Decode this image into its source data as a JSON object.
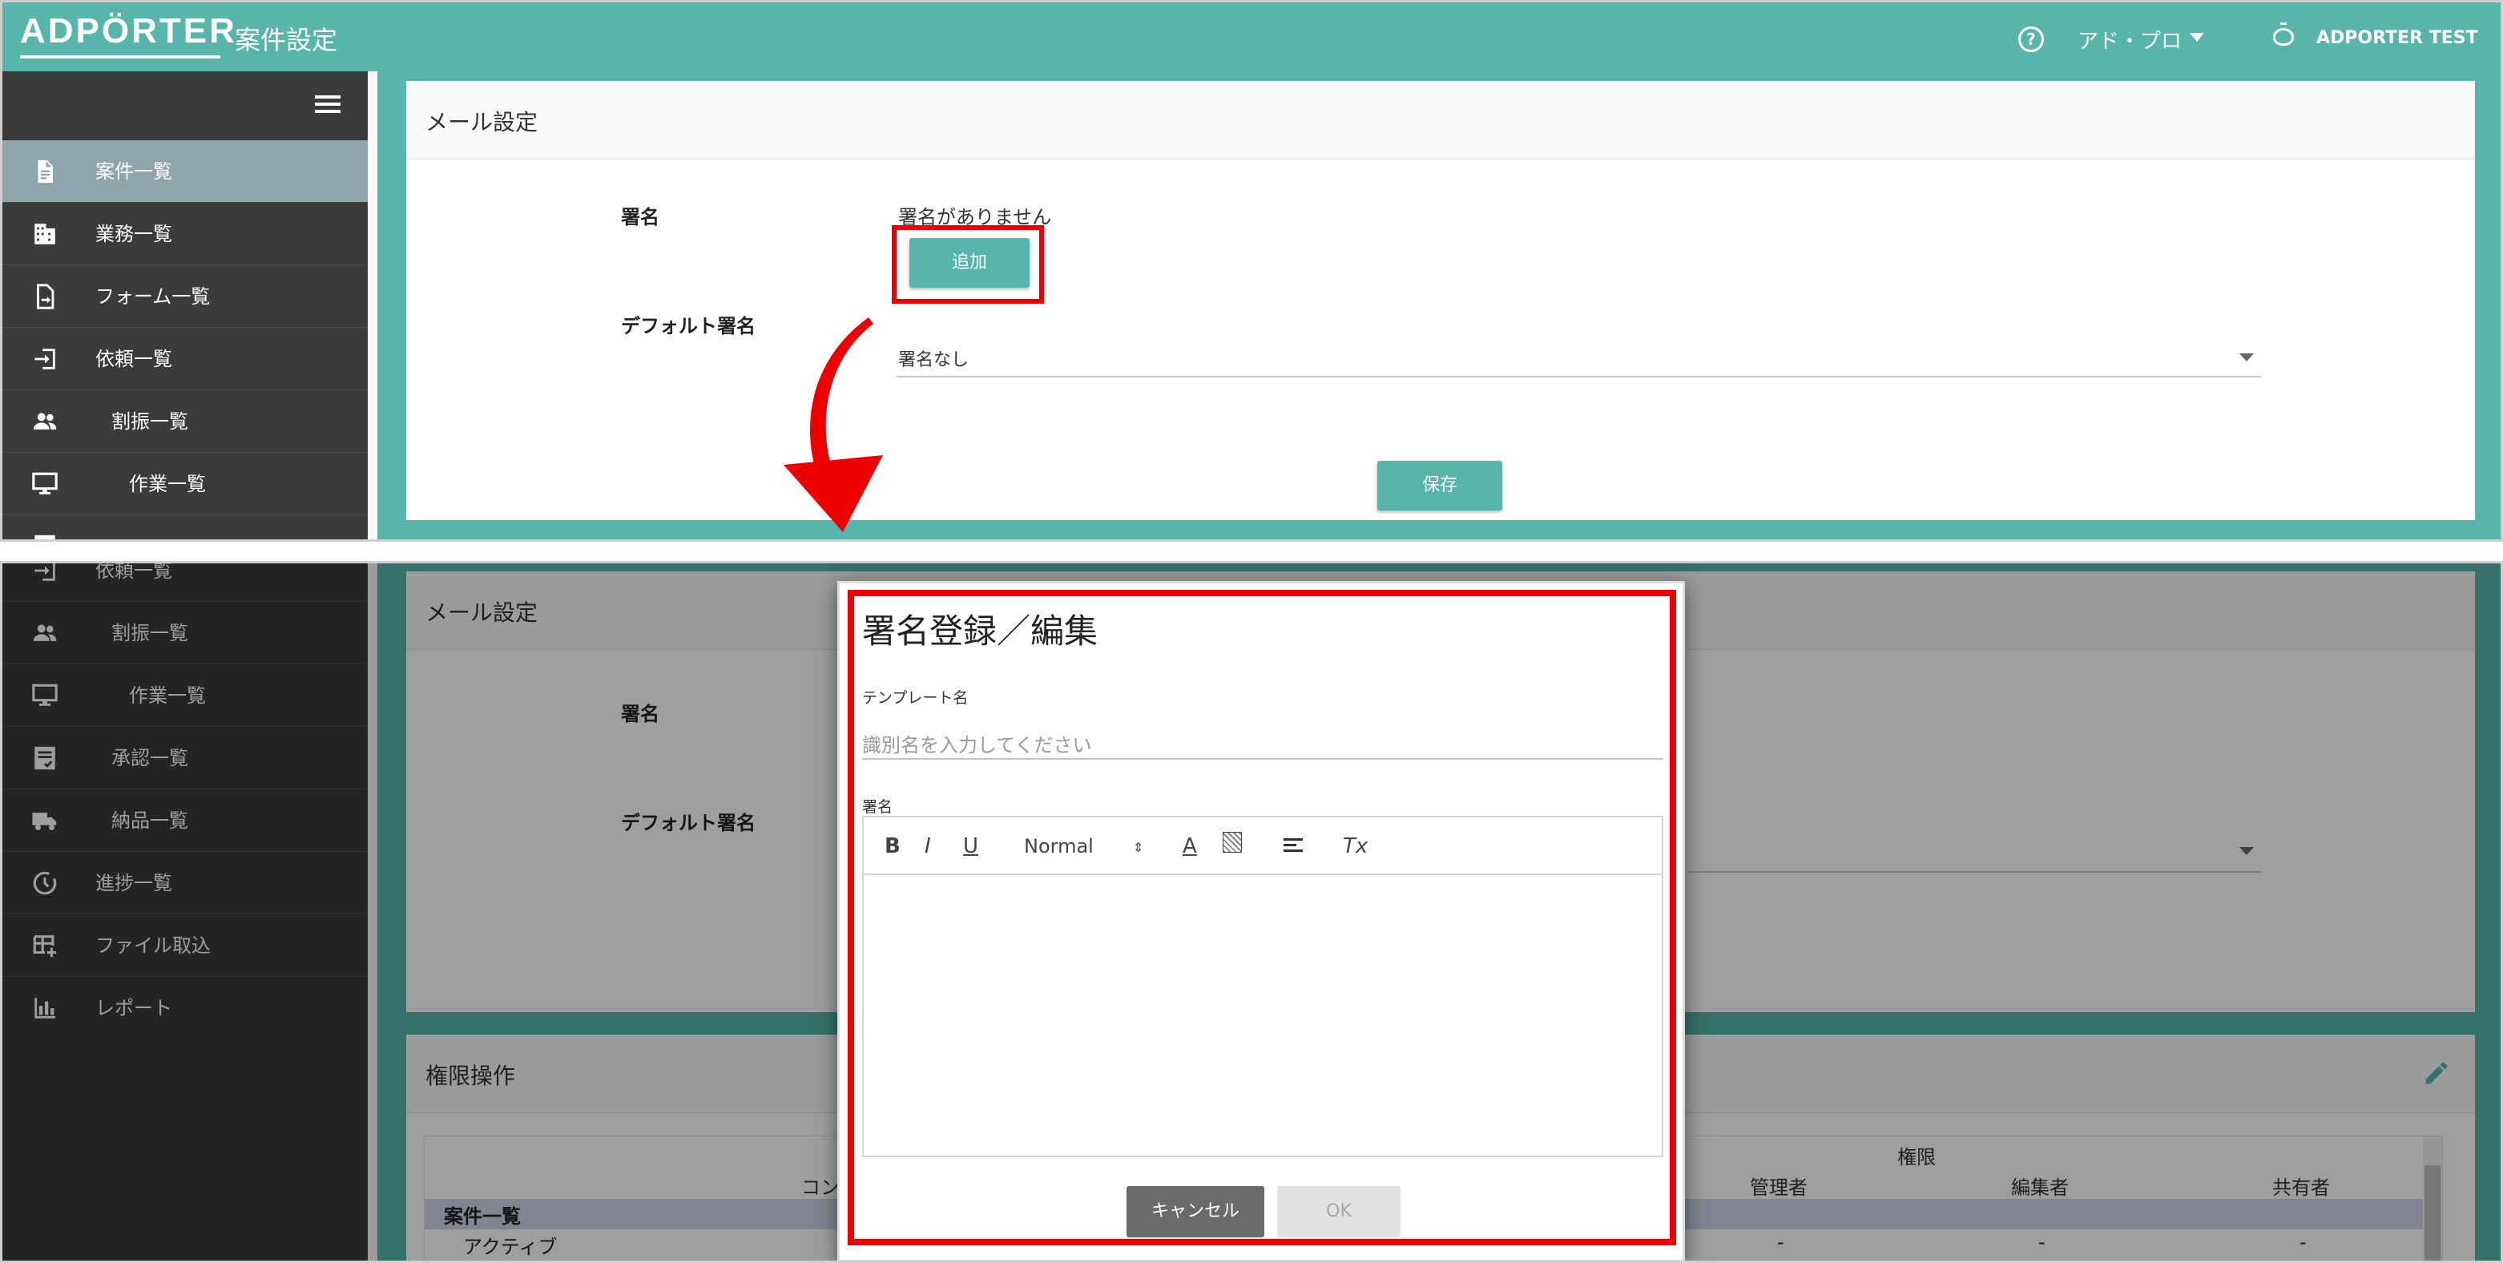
{
  "header": {
    "logo": "ADPÖRTER",
    "title": "案件設定",
    "help_icon": "question-circle-icon",
    "org": "アド・プロ",
    "user": "ADPORTER TEST"
  },
  "sidebar_top": {
    "items": [
      {
        "label": "案件一覧",
        "icon": "document-icon",
        "active": true
      },
      {
        "label": "業務一覧",
        "icon": "building-icon"
      },
      {
        "label": "フォーム一覧",
        "icon": "form-file-icon"
      },
      {
        "label": "依頼一覧",
        "icon": "login-arrow-icon"
      },
      {
        "label": "割振一覧",
        "icon": "people-icon"
      },
      {
        "label": "作業一覧",
        "icon": "monitor-icon"
      }
    ]
  },
  "sidebar_bottom": {
    "items": [
      {
        "label": "依頼一覧",
        "icon": "login-arrow-icon"
      },
      {
        "label": "割振一覧",
        "icon": "people-icon"
      },
      {
        "label": "作業一覧",
        "icon": "monitor-icon"
      },
      {
        "label": "承認一覧",
        "icon": "approval-icon"
      },
      {
        "label": "納品一覧",
        "icon": "truck-icon"
      },
      {
        "label": "進捗一覧",
        "icon": "clock-icon"
      },
      {
        "label": "ファイル取込",
        "icon": "table-add-icon"
      },
      {
        "label": "レポート",
        "icon": "bar-chart-icon"
      }
    ]
  },
  "mail_settings": {
    "title": "メール設定",
    "signature_label": "署名",
    "no_signature": "署名がありません",
    "add_button": "追加",
    "default_signature_label": "デフォルト署名",
    "default_signature_value": "署名なし",
    "save_button": "保存"
  },
  "permissions": {
    "title": "権限操作",
    "group_header": "権限",
    "columns": [
      "コン",
      "管理者",
      "編集者",
      "共有者"
    ],
    "section": "案件一覧",
    "row_label": "アクティブ",
    "row_values": [
      "-",
      "-",
      "-"
    ]
  },
  "modal": {
    "title": "署名登録／編集",
    "template_label": "テンプレート名",
    "template_placeholder": "識別名を入力してください",
    "signature_label": "署名",
    "toolbar": {
      "bold": "B",
      "italic": "I",
      "underline": "U",
      "size": "Normal",
      "font_color": "A",
      "clear": "Tx"
    },
    "cancel_button": "キャンセル",
    "ok_button": "OK"
  },
  "colors": {
    "brand": "#57b5ac",
    "sidebar": "#3b3b3b",
    "active_item": "#8ea6ab",
    "highlight": "#ee0000"
  }
}
